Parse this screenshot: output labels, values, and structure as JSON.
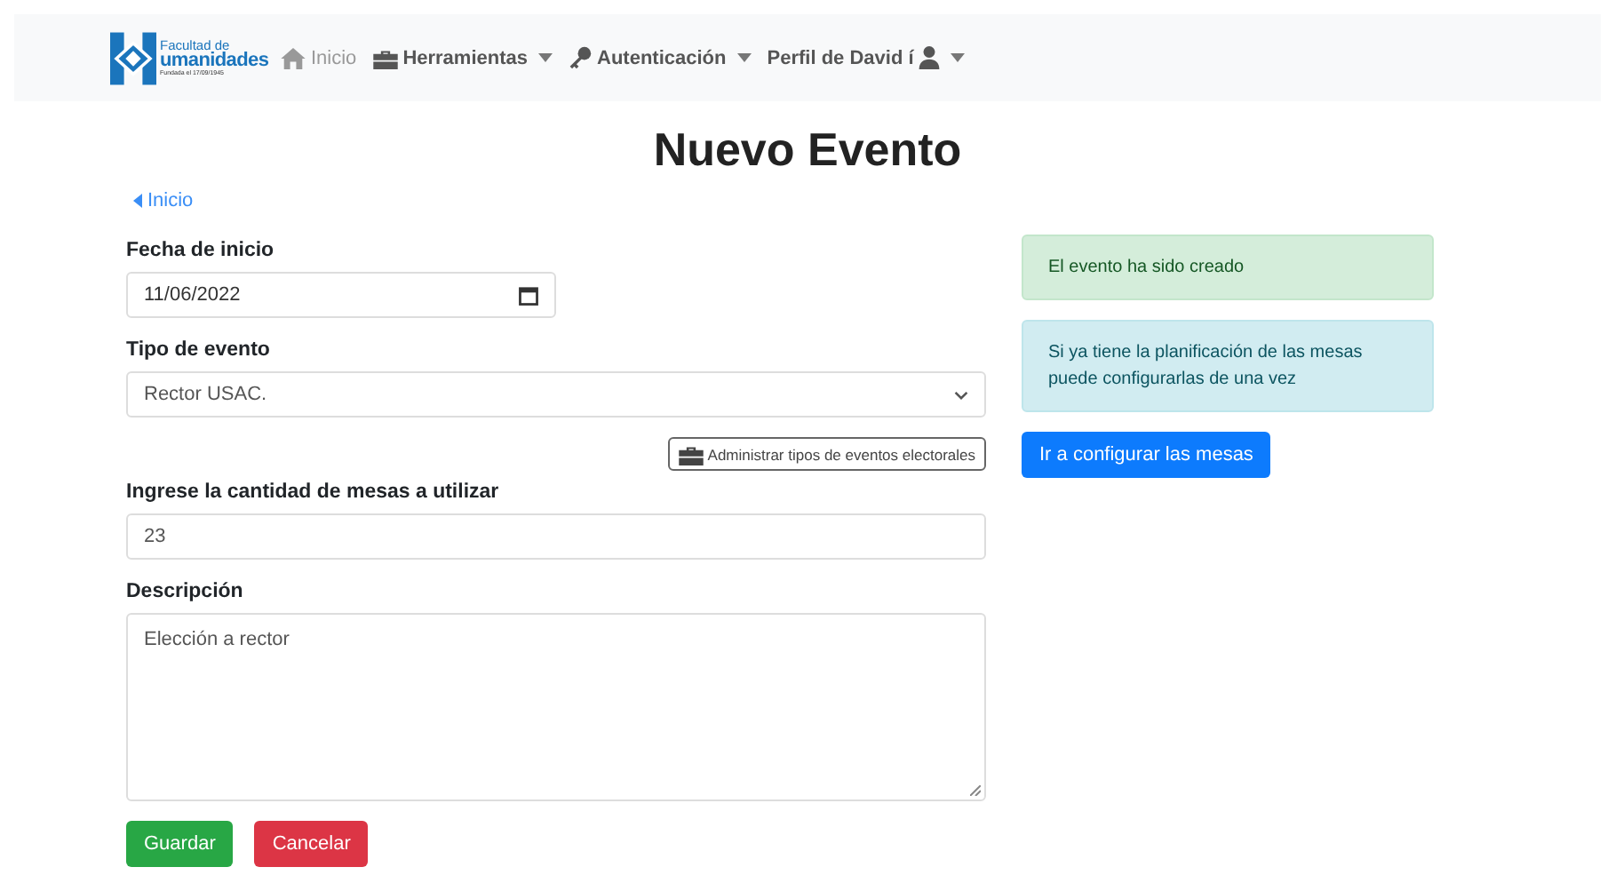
{
  "logo": {
    "line_1": "Facultad de",
    "line_2": "umanidades",
    "line_3": "Fundada el 17/09/1945"
  },
  "nav": [
    {
      "label": "Inicio",
      "dropdown": false,
      "disabled": true
    },
    {
      "label": "Herramientas",
      "dropdown": true,
      "disabled": false
    },
    {
      "label": "Autenticación",
      "dropdown": true,
      "disabled": false
    },
    {
      "label": "Perfil de David í",
      "dropdown": true,
      "disabled": false
    }
  ],
  "title": "Nuevo Evento",
  "back_link": "Inicio",
  "form": {
    "date": {
      "label": "Fecha de inicio",
      "value": "11/06/2022"
    },
    "event_type": {
      "label": "Tipo de evento",
      "value": "Rector USAC."
    },
    "manage_button": "Administrar tipos de eventos electorales",
    "tables": {
      "label": "Ingrese la cantidad de mesas a utilizar",
      "value": "23"
    },
    "description": {
      "label": "Descripción",
      "value": "Elección a rector"
    },
    "buttons": [
      {
        "label": "Guardar",
        "kind": "success"
      },
      {
        "label": "Cancelar",
        "kind": "danger"
      }
    ]
  },
  "alerts": [
    {
      "text": "El evento ha sido creado",
      "kind": "success"
    },
    {
      "text": "Si ya tiene la planificación de las mesas puede configurarlas de una vez",
      "kind": "info"
    }
  ],
  "configure_button": "Ir a configurar las mesas"
}
